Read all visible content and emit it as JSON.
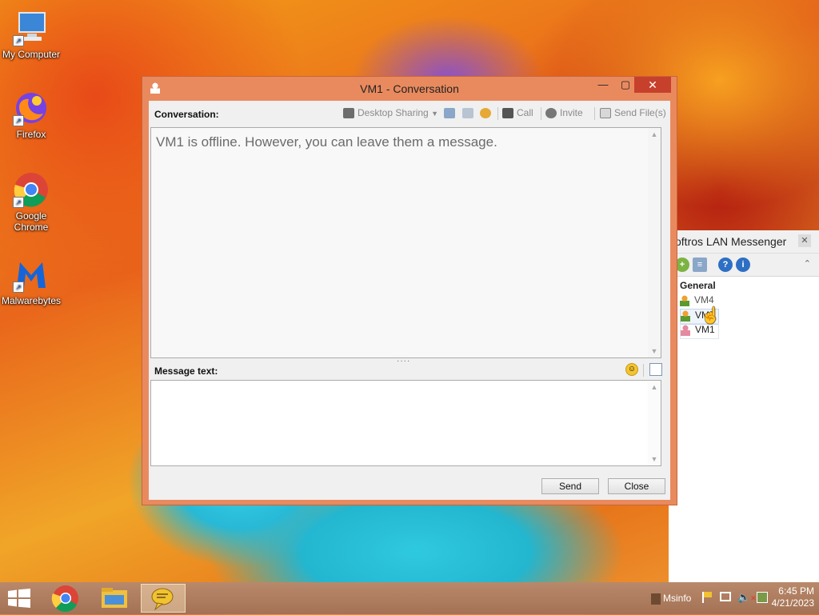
{
  "desktop": {
    "icons": [
      {
        "label": "My Computer",
        "icon": "computer-icon"
      },
      {
        "label": "Firefox",
        "icon": "firefox-icon"
      },
      {
        "label": "Google Chrome",
        "icon": "chrome-icon"
      },
      {
        "label": "Malwarebytes",
        "icon": "malwarebytes-icon"
      }
    ]
  },
  "lan_window": {
    "title": "oftros LAN Messenger",
    "group": "General",
    "contacts": [
      {
        "name": "VM4",
        "status_color": "#f0a030"
      },
      {
        "name": "VM5",
        "status_color": "#f0a030"
      },
      {
        "name": "VM1",
        "status_color": "#e58aa0"
      }
    ]
  },
  "conversation": {
    "title": "VM1 - Conversation",
    "conversation_label": "Conversation:",
    "toolbar": {
      "desktop_sharing": "Desktop Sharing",
      "call": "Call",
      "invite": "Invite",
      "send_files": "Send File(s)"
    },
    "offline_message": "VM1 is offline. However, you can leave them a message.",
    "message_label": "Message text:",
    "message_value": "",
    "send": "Send",
    "close": "Close"
  },
  "taskbar": {
    "tray_app_label": "Msinfo",
    "time": "6:45 PM",
    "date": "4/21/2023"
  },
  "colors": {
    "window_frame": "#e98a5e",
    "close_button": "#c7402b",
    "taskbar": "#a47154"
  }
}
